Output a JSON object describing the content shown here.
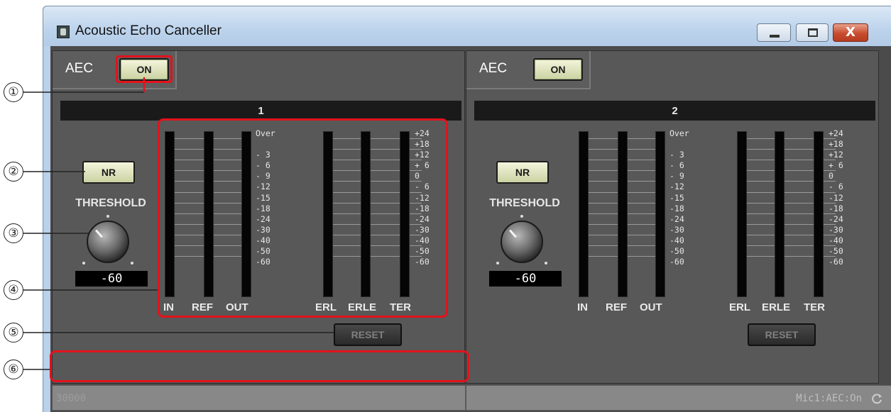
{
  "window": {
    "title": "Acoustic Echo Canceller",
    "controls": {
      "close_glyph": "X"
    }
  },
  "callouts": [
    "①",
    "②",
    "③",
    "④",
    "⑤",
    "⑥"
  ],
  "channels": [
    {
      "aec_label": "AEC",
      "aec_button": "ON",
      "channel_number": "1",
      "nr_button": "NR",
      "threshold_label": "THRESHOLD",
      "threshold_value": "-60",
      "reset_button": "RESET"
    },
    {
      "aec_label": "AEC",
      "aec_button": "ON",
      "channel_number": "2",
      "nr_button": "NR",
      "threshold_label": "THRESHOLD",
      "threshold_value": "-60",
      "reset_button": "RESET"
    }
  ],
  "meters": {
    "left_labels": [
      "IN",
      "REF",
      "OUT"
    ],
    "right_labels": [
      "ERL",
      "ERLE",
      "TER"
    ],
    "left_scale": [
      "Over",
      "",
      "- 3",
      "- 6",
      "- 9",
      "-12",
      "-15",
      "-18",
      "-24",
      "-30",
      "-40",
      "-50",
      "-60"
    ],
    "right_scale": [
      "+24",
      "+18",
      "+12",
      "+ 6",
      "0",
      "- 6",
      "-12",
      "-18",
      "-24",
      "-30",
      "-40",
      "-50",
      "-60"
    ]
  },
  "footer": {
    "device_id": "30000",
    "status": "Mic1:AEC:On",
    "refresh_icon": "refresh-icon"
  },
  "colors": {
    "highlight": "#e3121b",
    "panel_bg": "#585858",
    "button_on_bg": "#e3e6bf",
    "titlebar": "#bcd3ec"
  }
}
